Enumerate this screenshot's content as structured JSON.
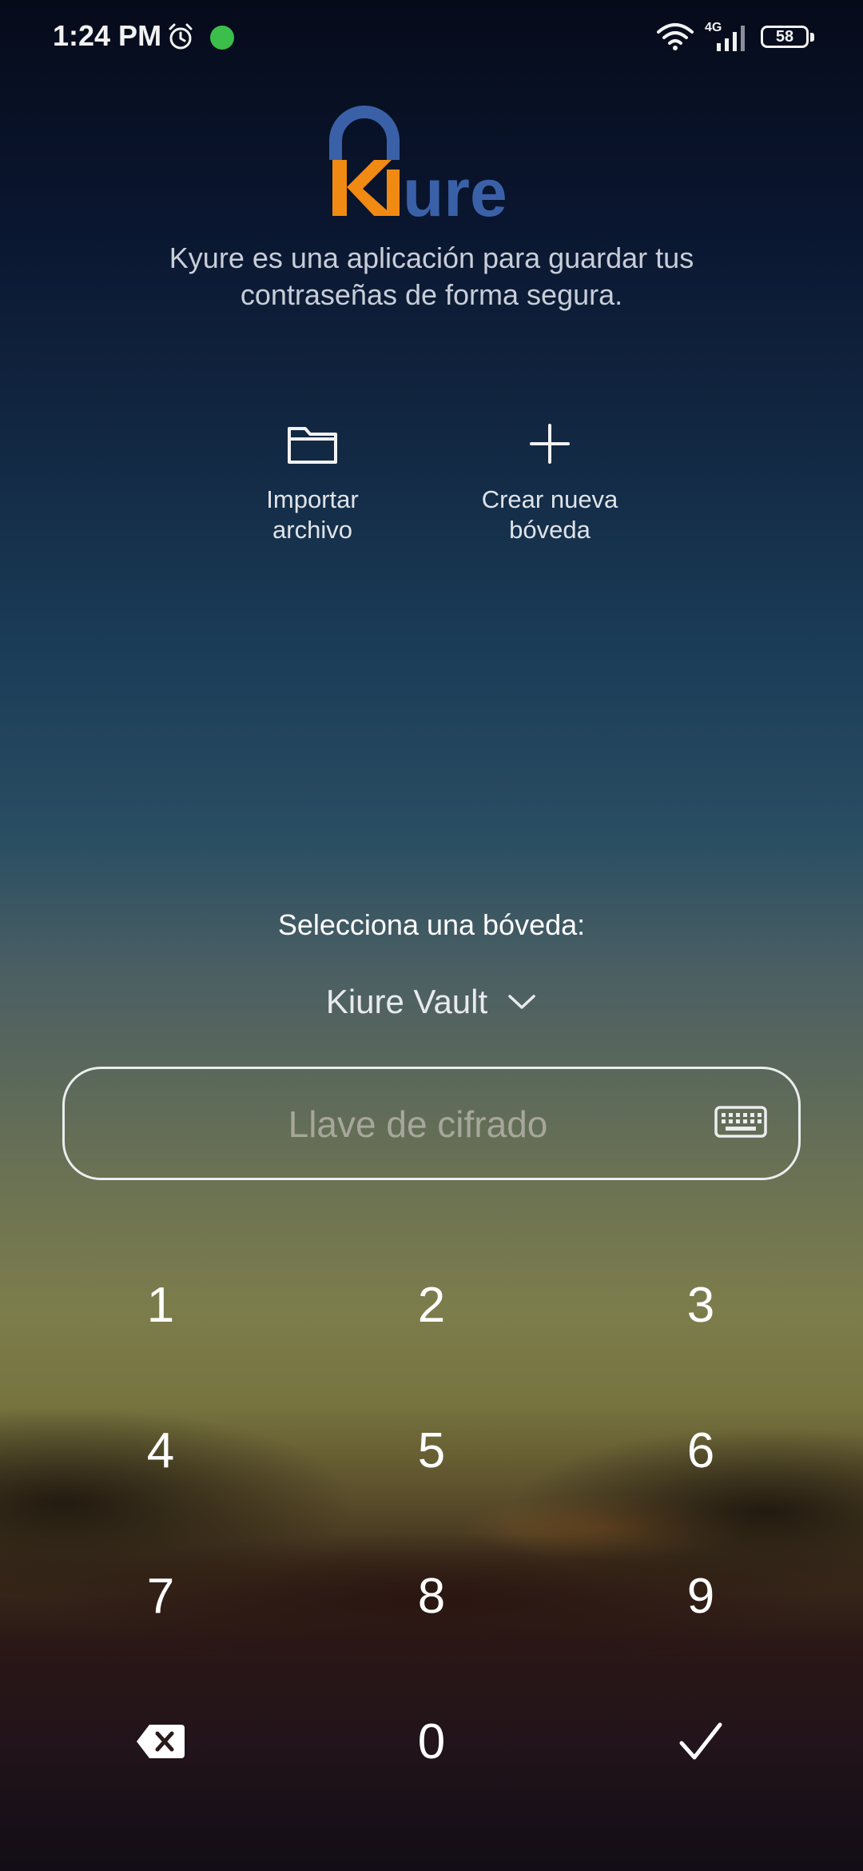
{
  "status_bar": {
    "time": "1:24 PM",
    "network_type": "4G",
    "battery_level": "58",
    "icons": [
      "alarm-icon",
      "app-notification-icon",
      "wifi-icon",
      "signal-icon",
      "battery-icon"
    ]
  },
  "header": {
    "logo_text": "Kiure",
    "logo_colors": {
      "primary": "#3a61a8",
      "accent": "#f08a12"
    },
    "tagline": "Kyure es una aplicación para guardar tus contraseñas de forma segura."
  },
  "actions": {
    "import_label": "Importar\narchivo",
    "import_icon": "folder-icon",
    "create_label": "Crear nueva\nbóveda",
    "create_icon": "plus-icon"
  },
  "vault": {
    "select_label": "Selecciona una bóveda:",
    "selected": "Kiure Vault"
  },
  "key_input": {
    "value": "",
    "placeholder": "Llave de cifrado",
    "icon": "keyboard-icon"
  },
  "keypad": {
    "keys": [
      "1",
      "2",
      "3",
      "4",
      "5",
      "6",
      "7",
      "8",
      "9",
      "0"
    ],
    "delete_icon": "backspace-icon",
    "confirm_icon": "check-icon"
  }
}
